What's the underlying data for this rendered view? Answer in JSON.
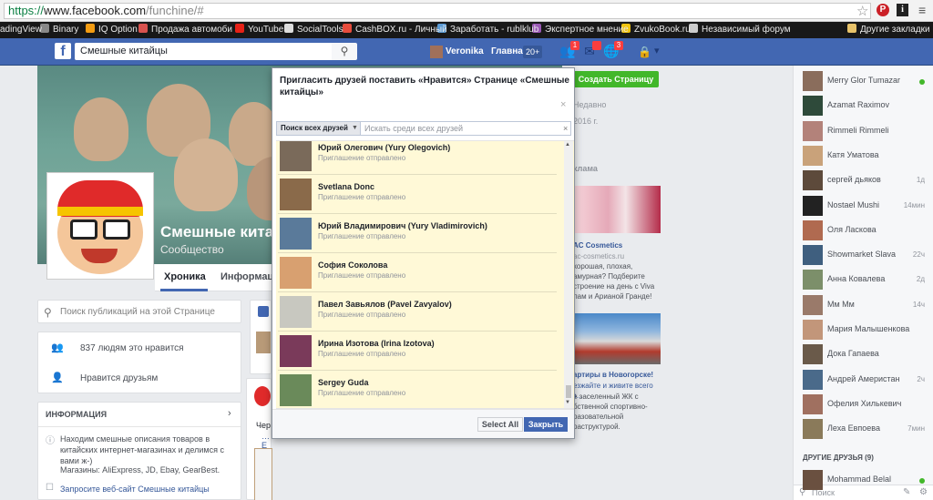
{
  "browser": {
    "url_scheme": "https://",
    "url_host": "www.facebook.com",
    "url_path": "/funchine/#",
    "bookmarks": [
      {
        "label": "adingView",
        "color": "#333"
      },
      {
        "label": "Binary",
        "color": "#888"
      },
      {
        "label": "IQ Option",
        "color": "#f39c12"
      },
      {
        "label": "Продажа автомоби",
        "color": "#d9534f"
      },
      {
        "label": "YouTube",
        "color": "#e62117"
      },
      {
        "label": "SocialTools",
        "color": "#dddddd"
      },
      {
        "label": "CashBOX.ru - Личный",
        "color": "#e74c3c"
      },
      {
        "label": "Заработать - rublklub",
        "color": "#5b9bd5"
      },
      {
        "label": "Экспертное мнение",
        "color": "#9b59b6"
      },
      {
        "label": "ZvukoBook.ru",
        "color": "#f1c40f"
      },
      {
        "label": "Независимый форум",
        "color": "#cccccc"
      }
    ],
    "other_bookmarks": "Другие закладки"
  },
  "topbar": {
    "search_value": "Смешные китайцы",
    "user_name": "Veronika",
    "home_label": "Главная",
    "home_count": "20+",
    "friend_badge": "1",
    "msg_badge": "",
    "notif_badge": "3"
  },
  "page": {
    "title": "Смешные кита",
    "subtitle": "Сообщество",
    "tabs": [
      "Хроника",
      "Информац"
    ],
    "search_placeholder": "Поиск публикаций на этой Странице",
    "likes_text": "837 людям это нравится",
    "friends_like": "Нравится друзьям",
    "info_header": "ИНФОРМАЦИЯ",
    "info_text": "Находим смешные описания товаров в китайских интернет-магазинах и делимся с вами ж-)",
    "info_stores": "Магазины: AliExpress, JD, Ebay, GearBest.",
    "info_link": "Запросите веб-сайт Смешные китайцы",
    "mid_text1": "Чер",
    "mid_text2": "…E"
  },
  "rightcol": {
    "create_button": "Создать Страницу",
    "recent": "Недавно",
    "year": "2016 г.",
    "ads_header": "клама",
    "ad1_title": "AC Cosmetics",
    "ad1_url": "ac-cosmetics.ru",
    "ad1_text": "хорошая, плохая, амурная? Подберите строение на день с Viva лам и Арианой Гранде!",
    "ad2_title": "артиры в Новогорске!",
    "ad2_url": "езжайте и живите всего з...",
    "ad2_text": "е заселенный ЖК с бственной спортивно-разовательной раструктурой."
  },
  "chat": {
    "friends": [
      {
        "name": "Merry Glor Tumazar",
        "time": "",
        "online": true,
        "color": "#8a6d5c"
      },
      {
        "name": "Azamat Raximov",
        "time": "",
        "online": false,
        "color": "#2e4a3a"
      },
      {
        "name": "Rimmeli Rimmeli",
        "time": "",
        "online": false,
        "color": "#b3827a"
      },
      {
        "name": "Катя Уматова",
        "time": "",
        "online": false,
        "color": "#c9a27a"
      },
      {
        "name": "сергей дьяков",
        "time": "1д",
        "online": false,
        "color": "#5d4a3b"
      },
      {
        "name": "Nostael Mushi",
        "time": "14мин",
        "online": false,
        "color": "#222222"
      },
      {
        "name": "Оля Ласкова",
        "time": "",
        "online": false,
        "color": "#b06a50"
      },
      {
        "name": "Showmarket Slava",
        "time": "22ч",
        "online": false,
        "color": "#3f5f7f"
      },
      {
        "name": "Анна Ковалева",
        "time": "2д",
        "online": false,
        "color": "#7c8f6a"
      },
      {
        "name": "Мм Мм",
        "time": "14ч",
        "online": false,
        "color": "#9a7a6a"
      },
      {
        "name": "Мария Малышенкова",
        "time": "",
        "online": false,
        "color": "#c2967a"
      },
      {
        "name": "Дока Гапаева",
        "time": "",
        "online": false,
        "color": "#6a5a4a"
      },
      {
        "name": "Андрей Америстан",
        "time": "2ч",
        "online": false,
        "color": "#4a6a8a"
      },
      {
        "name": "Офелия Хилькевич",
        "time": "",
        "online": false,
        "color": "#a07060"
      },
      {
        "name": "Леха Евпоева",
        "time": "7мин",
        "online": false,
        "color": "#8a7a5a"
      }
    ],
    "other_header": "ДРУГИЕ ДРУЗЬЯ (9)",
    "other_friend": {
      "name": "Mohammad Belal",
      "online": true,
      "color": "#6a5040"
    },
    "search_placeholder": "Поиск"
  },
  "modal": {
    "title": "Пригласить друзей поставить «Нравится» Странице «Смешные китайцы»",
    "filter_label": "Поиск всех друзей",
    "search_placeholder": "Искать среди всех друзей",
    "select_all": "Select All",
    "close": "Закрыть",
    "invites": [
      {
        "name": "Юрий Олегович (Yury Olegovich)",
        "status": "Приглашение отправлено",
        "color": "#7a6a5a"
      },
      {
        "name": "Svetlana Donc",
        "status": "Приглашение отправлено",
        "color": "#8a6a4a"
      },
      {
        "name": "Юрий Владимирович (Yury Vladimirovich)",
        "status": "Приглашение отправлено",
        "color": "#5a7a9a"
      },
      {
        "name": "София Соколова",
        "status": "Приглашение отправлено",
        "color": "#d8a070"
      },
      {
        "name": "Павел Завьялов (Pavel Zavyalov)",
        "status": "Приглашение отправлено",
        "color": "#c8c8c0"
      },
      {
        "name": "Ирина Изотова (Irina Izotova)",
        "status": "Приглашение отправлено",
        "color": "#7a3a5a"
      },
      {
        "name": "Sergey Guda",
        "status": "Приглашение отправлено",
        "color": "#6a8a5a"
      }
    ]
  }
}
